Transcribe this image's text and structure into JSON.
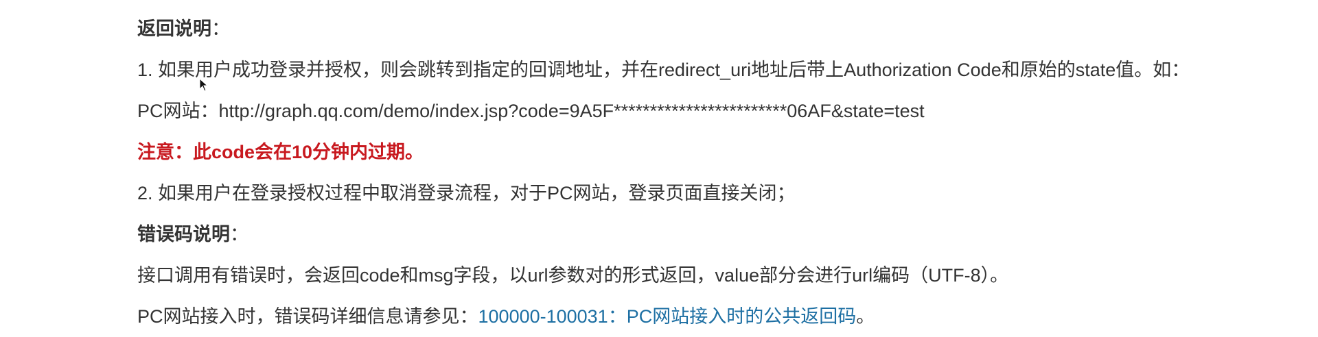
{
  "doc": {
    "return_heading": "返回说明",
    "return_heading_colon": "：",
    "item1": "1. 如果用户成功登录并授权，则会跳转到指定的回调地址，并在redirect_uri地址后带上Authorization Code和原始的state值。如：",
    "pc_example": "PC网站：http://graph.qq.com/demo/index.jsp?code=9A5F************************06AF&state=test",
    "notice": "注意：此code会在10分钟内过期。",
    "item2": "2. 如果用户在登录授权过程中取消登录流程，对于PC网站，登录页面直接关闭；",
    "error_heading": "错误码说明",
    "error_heading_colon": "：",
    "error_desc": "接口调用有错误时，会返回code和msg字段，以url参数对的形式返回，value部分会进行url编码（UTF-8）。",
    "pc_error_prefix": "PC网站接入时，错误码详细信息请参见：",
    "pc_error_link": "100000-100031：PC网站接入时的公共返回码",
    "pc_error_suffix": "。"
  },
  "colors": {
    "text": "#333333",
    "notice": "#c8191f",
    "link": "#1d6fa3"
  },
  "icons": {
    "cursor": "mouse-pointer-icon"
  }
}
